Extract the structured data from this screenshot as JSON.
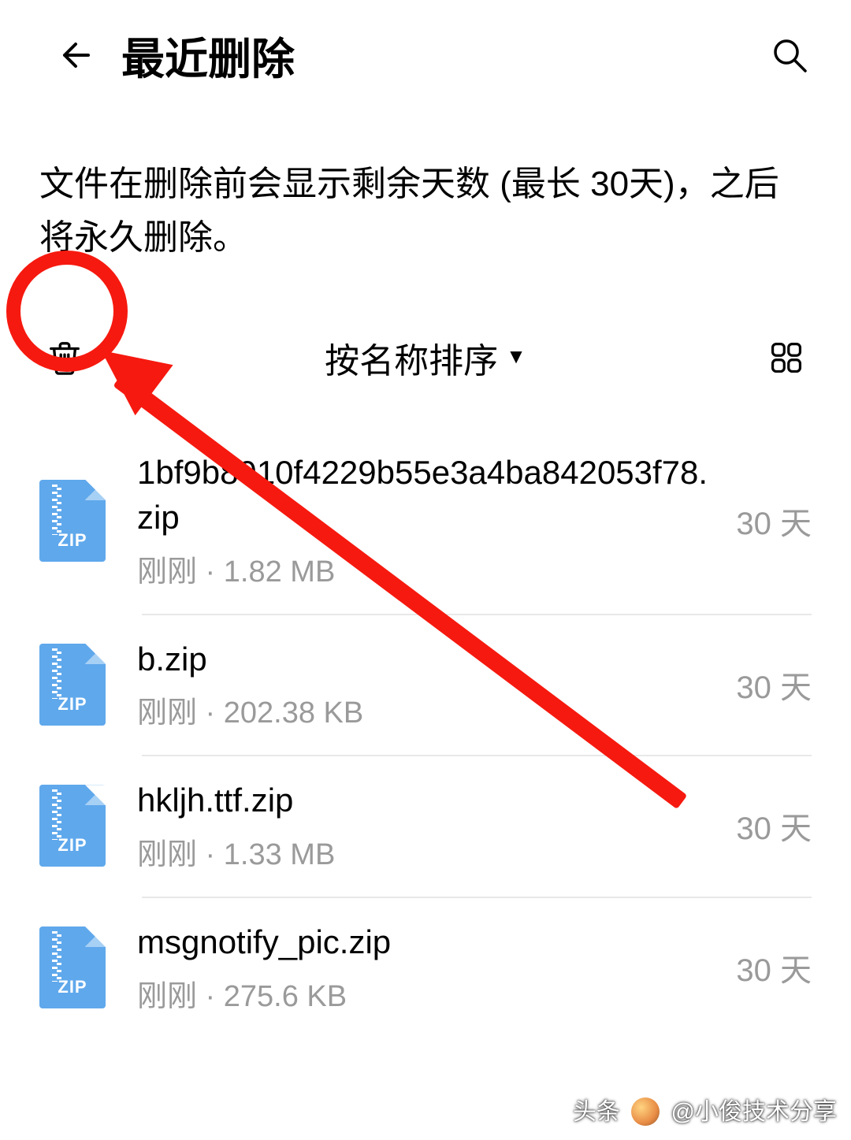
{
  "header": {
    "title": "最近删除"
  },
  "desc": "文件在删除前会显示剩余天数 (最长 30天)，之后将永久删除。",
  "toolbar": {
    "sort_label": "按名称排序"
  },
  "zip_badge": "ZIP",
  "items": [
    {
      "name": "1bf9b8910f4229b55e3a4ba842053f78.zip",
      "info": "刚刚 · 1.82 MB",
      "days": "30 天"
    },
    {
      "name": "b.zip",
      "info": "刚刚 · 202.38 KB",
      "days": "30 天"
    },
    {
      "name": "hkljh.ttf.zip",
      "info": "刚刚 · 1.33 MB",
      "days": "30 天"
    },
    {
      "name": "msgnotify_pic.zip",
      "info": "刚刚 · 275.6 KB",
      "days": "30 天"
    }
  ],
  "watermark": {
    "prefix": "头条",
    "name": "@小俊技术分享"
  }
}
